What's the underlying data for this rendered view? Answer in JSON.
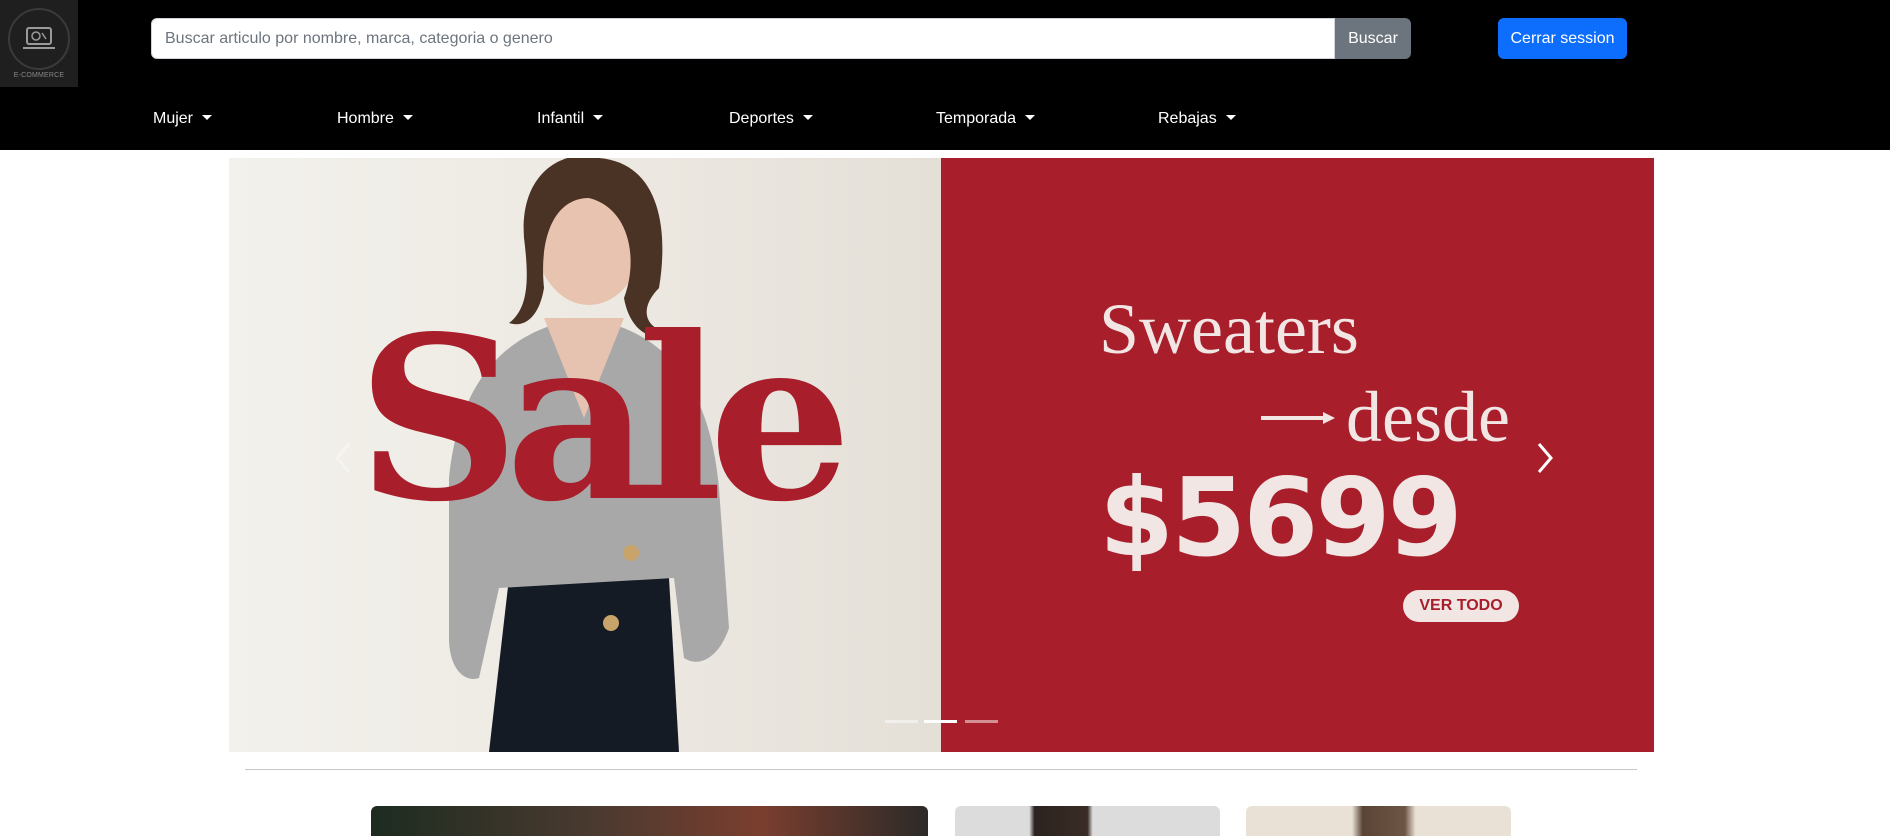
{
  "header": {
    "logo_caption": "E-COMMERCE",
    "search_placeholder": "Buscar articulo por nombre, marca, categoria o genero",
    "search_button": "Buscar",
    "logout_button": "Cerrar session"
  },
  "nav": {
    "items": [
      {
        "label": "Mujer"
      },
      {
        "label": "Hombre"
      },
      {
        "label": "Infantil"
      },
      {
        "label": "Deportes"
      },
      {
        "label": "Temporada"
      },
      {
        "label": "Rebajas"
      }
    ]
  },
  "carousel": {
    "active_index": 1,
    "slide": {
      "headline": "Sale",
      "title": "Sweaters",
      "subtitle": "desde",
      "price": "$5699",
      "cta": "VER TODO"
    }
  },
  "colors": {
    "brand_red": "#a81e2b",
    "primary_blue": "#0d6efd",
    "secondary_gray": "#6c757d"
  }
}
